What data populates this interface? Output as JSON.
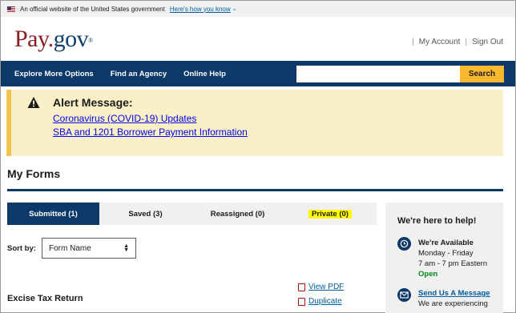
{
  "gov_banner": {
    "text": "An official website of the United States government",
    "link": "Here's how you know",
    "chevron": "⌄"
  },
  "header": {
    "logo_pay": "Pay",
    "logo_dot": ".",
    "logo_gov": "gov",
    "logo_reg": "®",
    "my_account": "My Account",
    "separator": "|",
    "sign_out": "Sign Out"
  },
  "nav": {
    "items": [
      "Explore More Options",
      "Find an Agency",
      "Online Help"
    ],
    "search_value": "",
    "search_button": "Search"
  },
  "alert": {
    "icon": "warning-icon",
    "title": "Alert Message:",
    "links": [
      "Coronavirus (COVID-19) Updates",
      "SBA and 1201 Borrower Payment Information"
    ]
  },
  "page": {
    "title": "My Forms"
  },
  "tabs": [
    {
      "label": "Submitted (1)",
      "active": true
    },
    {
      "label": "Saved (3)",
      "active": false
    },
    {
      "label": "Reassigned (0)",
      "active": false
    },
    {
      "label": "Private (0)",
      "active": false,
      "highlight": "#ffff00"
    }
  ],
  "sort": {
    "label": "Sort by:",
    "selected": "Form Name"
  },
  "forms": [
    {
      "name": "Excise Tax Return",
      "actions": [
        "View PDF",
        "Duplicate"
      ]
    }
  ],
  "help": {
    "title": "We're here to help!",
    "available_title": "We're Available",
    "days": "Monday - Friday",
    "hours": "7 am - 7 pm Eastern",
    "status": "Open",
    "send_message": "Send Us A Message",
    "experiencing": "We are experiencing"
  },
  "colors": {
    "nav_bg": "#0d3968",
    "search_button": "#fbb72e",
    "alert_bg": "#faf0c8",
    "alert_border": "#f2c14e",
    "link": "#005ea2",
    "open_status": "#008817",
    "logo_pay": "#8a1f24"
  }
}
